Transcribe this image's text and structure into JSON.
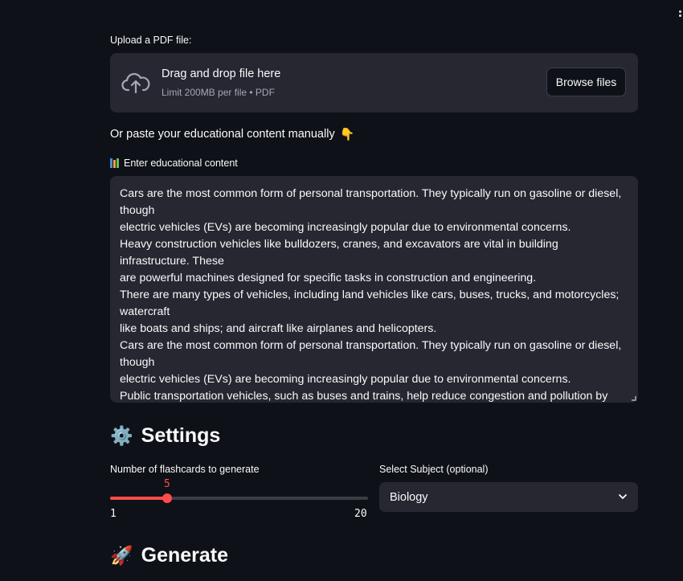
{
  "upload": {
    "label": "Upload a PDF file:",
    "drop_title": "Drag and drop file here",
    "drop_sub": "Limit 200MB per file • PDF",
    "browse_label": "Browse files"
  },
  "paste_prompt": "Or paste your educational content manually",
  "content": {
    "label": "Enter educational content",
    "text": "Cars are the most common form of personal transportation. They typically run on gasoline or diesel, though\nelectric vehicles (EVs) are becoming increasingly popular due to environmental concerns.\nHeavy construction vehicles like bulldozers, cranes, and excavators are vital in building infrastructure. These\nare powerful machines designed for specific tasks in construction and engineering.\nThere are many types of vehicles, including land vehicles like cars, buses, trucks, and motorcycles; watercraft\nlike boats and ships; and aircraft like airplanes and helicopters.\nCars are the most common form of personal transportation. They typically run on gasoline or diesel, though\nelectric vehicles (EVs) are becoming increasingly popular due to environmental concerns.\nPublic transportation vehicles, such as buses and trains, help reduce congestion and pollution by"
  },
  "settings": {
    "heading": "Settings",
    "slider": {
      "label": "Number of flashcards to generate",
      "value": 5,
      "value_text": "5",
      "min": 1,
      "max": 20,
      "min_text": "1",
      "max_text": "20"
    },
    "subject": {
      "label": "Select Subject (optional)",
      "selected": "Biology"
    }
  },
  "generate": {
    "heading": "Generate"
  },
  "colors": {
    "background": "#0e1117",
    "widget": "#262730",
    "accent": "#ff4b4b"
  }
}
